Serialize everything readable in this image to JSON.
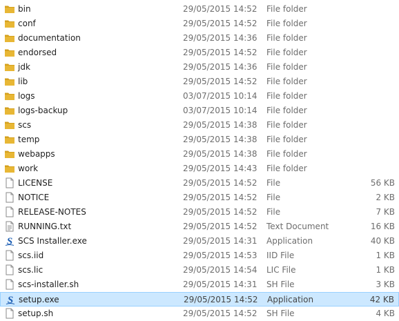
{
  "files": [
    {
      "name": "bin",
      "date": "29/05/2015 14:52",
      "type": "File folder",
      "size": "",
      "icon": "folder-icon"
    },
    {
      "name": "conf",
      "date": "29/05/2015 14:52",
      "type": "File folder",
      "size": "",
      "icon": "folder-icon"
    },
    {
      "name": "documentation",
      "date": "29/05/2015 14:36",
      "type": "File folder",
      "size": "",
      "icon": "folder-icon"
    },
    {
      "name": "endorsed",
      "date": "29/05/2015 14:52",
      "type": "File folder",
      "size": "",
      "icon": "folder-icon"
    },
    {
      "name": "jdk",
      "date": "29/05/2015 14:36",
      "type": "File folder",
      "size": "",
      "icon": "folder-icon"
    },
    {
      "name": "lib",
      "date": "29/05/2015 14:52",
      "type": "File folder",
      "size": "",
      "icon": "folder-icon"
    },
    {
      "name": "logs",
      "date": "03/07/2015 10:14",
      "type": "File folder",
      "size": "",
      "icon": "folder-icon"
    },
    {
      "name": "logs-backup",
      "date": "03/07/2015 10:14",
      "type": "File folder",
      "size": "",
      "icon": "folder-icon"
    },
    {
      "name": "scs",
      "date": "29/05/2015 14:38",
      "type": "File folder",
      "size": "",
      "icon": "folder-icon"
    },
    {
      "name": "temp",
      "date": "29/05/2015 14:38",
      "type": "File folder",
      "size": "",
      "icon": "folder-icon"
    },
    {
      "name": "webapps",
      "date": "29/05/2015 14:38",
      "type": "File folder",
      "size": "",
      "icon": "folder-icon"
    },
    {
      "name": "work",
      "date": "29/05/2015 14:43",
      "type": "File folder",
      "size": "",
      "icon": "folder-icon"
    },
    {
      "name": "LICENSE",
      "date": "29/05/2015 14:52",
      "type": "File",
      "size": "56 KB",
      "icon": "blank-file-icon"
    },
    {
      "name": "NOTICE",
      "date": "29/05/2015 14:52",
      "type": "File",
      "size": "2 KB",
      "icon": "blank-file-icon"
    },
    {
      "name": "RELEASE-NOTES",
      "date": "29/05/2015 14:52",
      "type": "File",
      "size": "7 KB",
      "icon": "blank-file-icon"
    },
    {
      "name": "RUNNING.txt",
      "date": "29/05/2015 14:52",
      "type": "Text Document",
      "size": "16 KB",
      "icon": "text-file-icon"
    },
    {
      "name": "SCS Installer.exe",
      "date": "29/05/2015 14:31",
      "type": "Application",
      "size": "40 KB",
      "icon": "app-s-icon"
    },
    {
      "name": "scs.iid",
      "date": "29/05/2015 14:53",
      "type": "IID File",
      "size": "1 KB",
      "icon": "blank-file-icon"
    },
    {
      "name": "scs.lic",
      "date": "29/05/2015 14:54",
      "type": "LIC File",
      "size": "1 KB",
      "icon": "blank-file-icon"
    },
    {
      "name": "scs-installer.sh",
      "date": "29/05/2015 14:31",
      "type": "SH File",
      "size": "3 KB",
      "icon": "blank-file-icon"
    },
    {
      "name": "setup.exe",
      "date": "29/05/2015 14:52",
      "type": "Application",
      "size": "42 KB",
      "icon": "app-s-icon",
      "selected": true
    },
    {
      "name": "setup.sh",
      "date": "29/05/2015 14:52",
      "type": "SH File",
      "size": "4 KB",
      "icon": "blank-file-icon"
    }
  ],
  "colors": {
    "folder": "#e8b735",
    "folder_dark": "#d4a01e",
    "selection_bg": "#cce8ff",
    "selection_border": "#99d1ff",
    "app_icon": "#1e5fb4"
  }
}
